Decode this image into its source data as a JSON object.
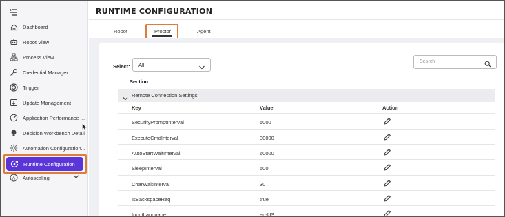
{
  "sidebar": {
    "items": [
      {
        "label": "Dashboard",
        "icon": "home-icon"
      },
      {
        "label": "Robot View",
        "icon": "robot-icon"
      },
      {
        "label": "Process View",
        "icon": "process-icon"
      },
      {
        "label": "Credential Manager",
        "icon": "key-icon"
      },
      {
        "label": "Trigger",
        "icon": "trigger-icon"
      },
      {
        "label": "Update Management",
        "icon": "update-icon"
      },
      {
        "label": "Application Performance ...",
        "icon": "speedometer-icon"
      },
      {
        "label": "Decision Workbench Detail",
        "icon": "bulb-icon"
      },
      {
        "label": "Automation Configuration...",
        "icon": "gear-icon"
      },
      {
        "label": "Runtime Configuration",
        "icon": "runtime-icon",
        "active": true
      },
      {
        "label": "Autoscaling",
        "icon": "autoscaling-icon"
      }
    ]
  },
  "header": {
    "title": "RUNTIME CONFIGURATION"
  },
  "tabs": [
    {
      "label": "Robot"
    },
    {
      "label": "Proctor",
      "selected": true
    },
    {
      "label": "Agent"
    }
  ],
  "filters": {
    "select_label": "Select:",
    "select_value": "All",
    "search_placeholder": "Search"
  },
  "table": {
    "section_header": "Section",
    "group_label": "Remote Connection Settings",
    "columns": [
      "Key",
      "Value",
      "Action"
    ],
    "rows": [
      {
        "key": "SecurityPromptInterval",
        "value": "5000"
      },
      {
        "key": "ExecuteCmdInterval",
        "value": "30000"
      },
      {
        "key": "AutoStartWaitInterval",
        "value": "60000"
      },
      {
        "key": "SleepInterval",
        "value": "500"
      },
      {
        "key": "CharWaitInterval",
        "value": "30"
      },
      {
        "key": "IsBackspaceReq",
        "value": "true"
      },
      {
        "key": "InputLanguage",
        "value": "en-US"
      }
    ]
  },
  "colors": {
    "accent": "#5a35d8",
    "highlight": "#e07b39"
  }
}
